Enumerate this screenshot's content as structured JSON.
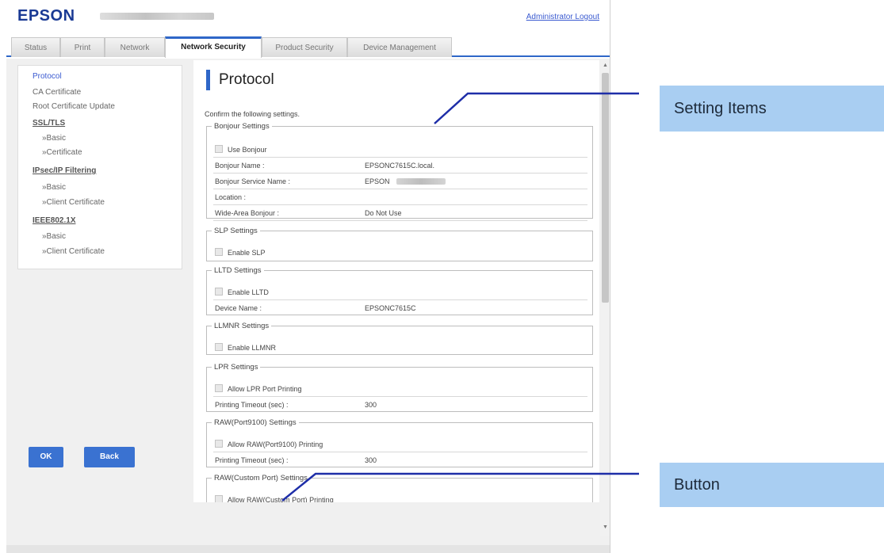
{
  "header": {
    "brand": "EPSON",
    "logout_link": "Administrator Logout"
  },
  "tabs": [
    {
      "label": "Status"
    },
    {
      "label": "Print"
    },
    {
      "label": "Network"
    },
    {
      "label": "Network Security",
      "active": true
    },
    {
      "label": "Product Security"
    },
    {
      "label": "Device Management"
    }
  ],
  "sidebar": {
    "items": [
      {
        "label": "Protocol"
      },
      {
        "label": "CA Certificate"
      },
      {
        "label": "Root Certificate Update"
      },
      {
        "label": "SSL/TLS"
      },
      {
        "label": "»Basic"
      },
      {
        "label": "»Certificate"
      },
      {
        "label": "IPsec/IP Filtering"
      },
      {
        "label": "»Basic"
      },
      {
        "label": "»Client Certificate"
      },
      {
        "label": "IEEE802.1X"
      },
      {
        "label": "»Basic"
      },
      {
        "label": "»Client Certificate"
      }
    ]
  },
  "main": {
    "title": "Protocol",
    "intro": "Confirm the following settings.",
    "groups": [
      {
        "legend": "Bonjour Settings",
        "rows": [
          {
            "checkbox": "Use Bonjour"
          },
          {
            "label": "Bonjour Name :",
            "value": "EPSONC7615C.local."
          },
          {
            "label": "Bonjour Service Name :",
            "value": "EPSON"
          },
          {
            "label": "Location :",
            "value": ""
          },
          {
            "label": "Wide-Area Bonjour :",
            "value": "Do Not Use"
          }
        ]
      },
      {
        "legend": "SLP Settings",
        "rows": [
          {
            "checkbox": "Enable SLP"
          }
        ]
      },
      {
        "legend": "LLTD Settings",
        "rows": [
          {
            "checkbox": "Enable LLTD"
          },
          {
            "label": "Device Name :",
            "value": "EPSONC7615C"
          }
        ]
      },
      {
        "legend": "LLMNR Settings",
        "rows": [
          {
            "checkbox": "Enable LLMNR"
          }
        ]
      },
      {
        "legend": "LPR Settings",
        "rows": [
          {
            "checkbox": "Allow LPR Port Printing"
          },
          {
            "label": "Printing Timeout (sec) :",
            "value": "300"
          }
        ]
      },
      {
        "legend": "RAW(Port9100) Settings",
        "rows": [
          {
            "checkbox": "Allow RAW(Port9100) Printing"
          },
          {
            "label": "Printing Timeout (sec) :",
            "value": "300"
          }
        ]
      },
      {
        "legend": "RAW(Custom Port) Settings",
        "rows": [
          {
            "checkbox": "Allow RAW(Custom Port) Printing"
          }
        ]
      }
    ],
    "ok_label": "OK",
    "back_label": "Back"
  },
  "callouts": {
    "setting_items": "Setting Items",
    "button": "Button"
  },
  "colors": {
    "brand_blue": "#1a3a94",
    "accent_blue": "#2f67c8",
    "button_blue": "#3a72d1",
    "callout_blue": "#a9cef2"
  }
}
